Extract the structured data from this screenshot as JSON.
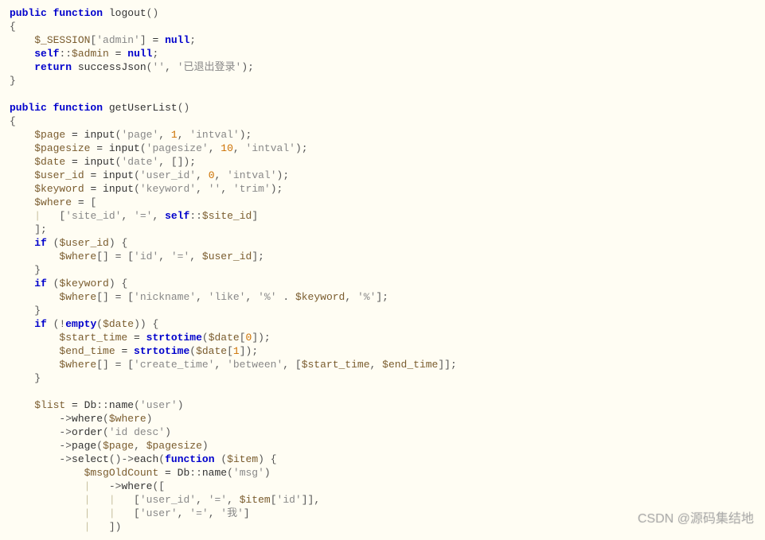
{
  "code": {
    "logout": {
      "decl": {
        "public": "public",
        "function": "function",
        "name": "logout"
      },
      "line1": {
        "session": "$_SESSION",
        "key": "'admin'",
        "eq": " = ",
        "null": "null"
      },
      "line2": {
        "self": "self",
        "dcolon": "::",
        "admin": "$admin",
        "eq": " = ",
        "null": "null"
      },
      "line3": {
        "return": "return",
        "fn": "successJson",
        "a1": "''",
        "a2": "'已退出登录'"
      }
    },
    "getUserList": {
      "decl": {
        "public": "public",
        "function": "function",
        "name": "getUserList"
      },
      "page": {
        "var": "$page",
        "fn": "input",
        "a1": "'page'",
        "a2": "1",
        "a3": "'intval'"
      },
      "pagesize": {
        "var": "$pagesize",
        "fn": "input",
        "a1": "'pagesize'",
        "a2": "10",
        "a3": "'intval'"
      },
      "date": {
        "var": "$date",
        "fn": "input",
        "a1": "'date'",
        "arr": "[]"
      },
      "userid": {
        "var": "$user_id",
        "fn": "input",
        "a1": "'user_id'",
        "a2": "0",
        "a3": "'intval'"
      },
      "keyword": {
        "var": "$keyword",
        "fn": "input",
        "a1": "'keyword'",
        "a2": "''",
        "a3": "'trim'"
      },
      "where": {
        "var": "$where",
        "siteid": "'site_id'",
        "eq": "'='",
        "self": "self",
        "prop": "$site_id"
      },
      "ifUser": {
        "cond": "$user_id",
        "wvar": "$where",
        "c1": "'id'",
        "c2": "'='",
        "c3": "$user_id"
      },
      "ifKw": {
        "cond": "$keyword",
        "wvar": "$where",
        "c1": "'nickname'",
        "c2": "'like'",
        "p1": "'%'",
        "kw": "$keyword",
        "p2": "'%'"
      },
      "ifDate": {
        "empty": "empty",
        "cond": "$date",
        "st": {
          "var": "$start_time",
          "fn": "strtotime",
          "d": "$date",
          "i": "0"
        },
        "et": {
          "var": "$end_time",
          "fn": "strtotime",
          "d": "$date",
          "i": "1"
        },
        "wvar": "$where",
        "c1": "'create_time'",
        "c2": "'between'",
        "sv": "$start_time",
        "ev": "$end_time"
      },
      "list": {
        "var": "$list",
        "db": "Db",
        "name": "name",
        "user": "'user'",
        "where": "where",
        "wv": "$where",
        "order": "order",
        "ov": "'id desc'",
        "pagefn": "page",
        "pv1": "$page",
        "pv2": "$pagesize",
        "select": "select",
        "each": "each",
        "function": "function",
        "item": "$item",
        "msgcount": "$msgOldCount",
        "msg": "'msg'",
        "uid": "'user_id'",
        "eq": "'='",
        "itemid": "'id'",
        "userk": "'user'",
        "wo": "'我'"
      }
    }
  },
  "watermark": "CSDN @源码集结地"
}
